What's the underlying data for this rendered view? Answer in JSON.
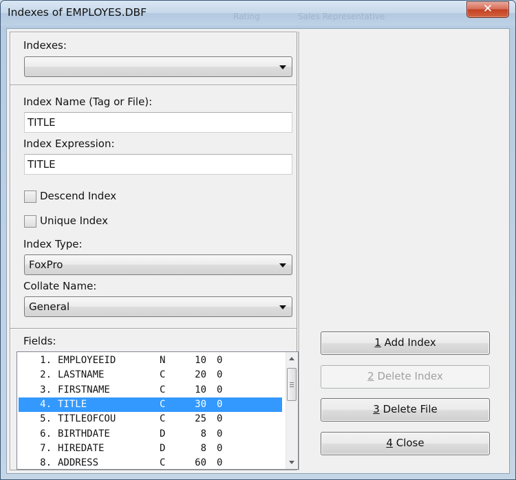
{
  "window": {
    "title": "Indexes of EMPLOYES.DBF",
    "close_glyph": "✕",
    "background_hint_1": "Rating",
    "background_hint_2": "Sales Representative"
  },
  "indexes": {
    "label": "Indexes:",
    "selected": ""
  },
  "index_name": {
    "label": "Index Name (Tag or File):",
    "value": "TITLE"
  },
  "index_expression": {
    "label": "Index Expression:",
    "value": "TITLE"
  },
  "descend_index": {
    "label": "Descend Index",
    "checked": false
  },
  "unique_index": {
    "label": "Unique Index",
    "checked": false
  },
  "index_type": {
    "label": "Index Type:",
    "selected": "FoxPro"
  },
  "collate_name": {
    "label": "Collate Name:",
    "selected": "General"
  },
  "fields": {
    "label": "Fields:",
    "selected_index": 3,
    "rows": [
      {
        "no": "1.",
        "name": "EMPLOYEEID",
        "type": "N",
        "len": "10",
        "dec": "0"
      },
      {
        "no": "2.",
        "name": "LASTNAME",
        "type": "C",
        "len": "20",
        "dec": "0"
      },
      {
        "no": "3.",
        "name": "FIRSTNAME",
        "type": "C",
        "len": "10",
        "dec": "0"
      },
      {
        "no": "4.",
        "name": "TITLE",
        "type": "C",
        "len": "30",
        "dec": "0"
      },
      {
        "no": "5.",
        "name": "TITLEOFCOU",
        "type": "C",
        "len": "25",
        "dec": "0"
      },
      {
        "no": "6.",
        "name": "BIRTHDATE",
        "type": "D",
        "len": "8",
        "dec": "0"
      },
      {
        "no": "7.",
        "name": "HIREDATE",
        "type": "D",
        "len": "8",
        "dec": "0"
      },
      {
        "no": "8.",
        "name": "ADDRESS",
        "type": "C",
        "len": "60",
        "dec": "0"
      }
    ]
  },
  "buttons": {
    "add_index": {
      "key": "1",
      "label": " Add Index",
      "enabled": true
    },
    "delete_index": {
      "key": "2",
      "label": " Delete Index",
      "enabled": false
    },
    "delete_file": {
      "key": "3",
      "label": " Delete File",
      "enabled": true
    },
    "close": {
      "key": "4",
      "label": " Close",
      "enabled": true
    }
  },
  "colors": {
    "selection": "#3399ff",
    "close_button": "#c44124",
    "disabled_text": "#a0a0a0"
  }
}
